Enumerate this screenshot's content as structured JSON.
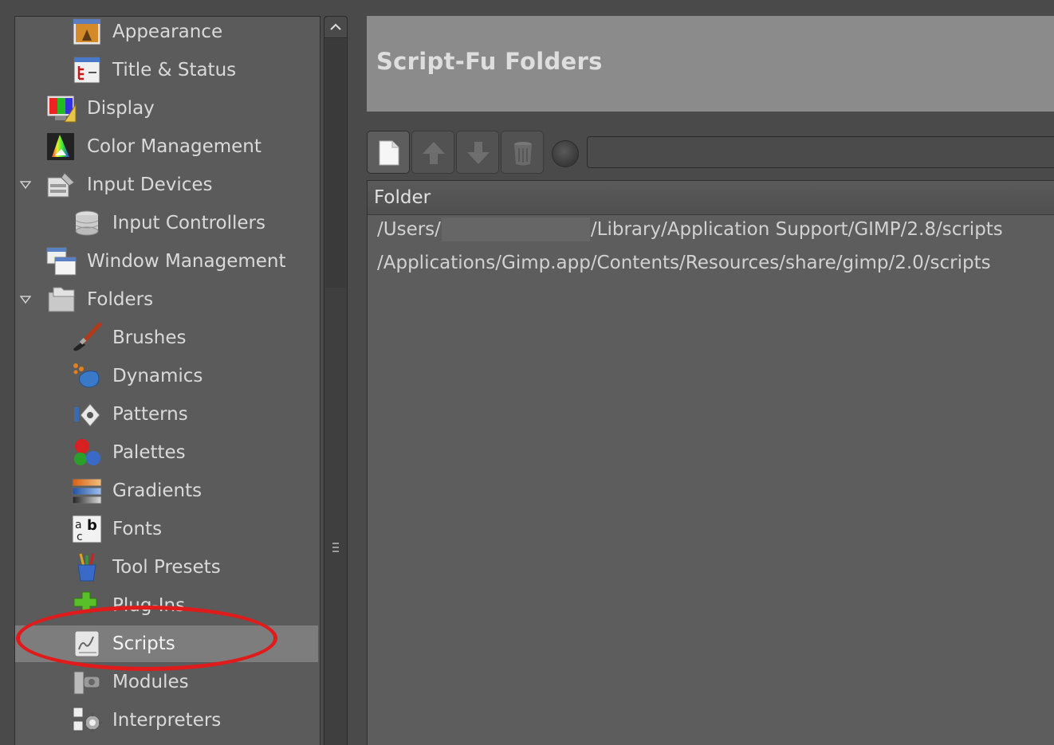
{
  "tree": {
    "items": [
      {
        "label": "Appearance",
        "icon": "appearance-icon"
      },
      {
        "label": "Title & Status",
        "icon": "title-status-icon"
      },
      {
        "label": "Display",
        "icon": "display-icon"
      },
      {
        "label": "Color Management",
        "icon": "color-management-icon"
      },
      {
        "label": "Input Devices",
        "icon": "input-devices-icon",
        "expanded": true
      },
      {
        "label": "Input Controllers",
        "icon": "input-controllers-icon"
      },
      {
        "label": "Window Management",
        "icon": "window-management-icon"
      },
      {
        "label": "Folders",
        "icon": "folders-icon",
        "expanded": true
      },
      {
        "label": "Brushes",
        "icon": "brushes-icon"
      },
      {
        "label": "Dynamics",
        "icon": "dynamics-icon"
      },
      {
        "label": "Patterns",
        "icon": "patterns-icon"
      },
      {
        "label": "Palettes",
        "icon": "palettes-icon"
      },
      {
        "label": "Gradients",
        "icon": "gradients-icon"
      },
      {
        "label": "Fonts",
        "icon": "fonts-icon"
      },
      {
        "label": "Tool Presets",
        "icon": "tool-presets-icon"
      },
      {
        "label": "Plug-Ins",
        "icon": "plug-ins-icon"
      },
      {
        "label": "Scripts",
        "icon": "scripts-icon",
        "selected": true
      },
      {
        "label": "Modules",
        "icon": "modules-icon"
      },
      {
        "label": "Interpreters",
        "icon": "interpreters-icon"
      }
    ]
  },
  "panel": {
    "title": "Script-Fu Folders",
    "toolbar": {
      "new_icon": "new-document-icon",
      "up_icon": "arrow-up-icon",
      "down_icon": "arrow-down-icon",
      "delete_icon": "trash-icon",
      "path_value": ""
    },
    "column_header": "Folder",
    "folders": [
      {
        "prefix": "/Users/",
        "suffix": "/Library/Application Support/GIMP/2.8/scripts",
        "redacted": true
      },
      {
        "prefix": "/Applications/Gimp.app/Contents/Resources/share/gimp/2.0/scripts",
        "suffix": "",
        "redacted": false
      }
    ]
  },
  "colors": {
    "highlight": "#e01b1b",
    "selected_row": "#7d7d7d",
    "header_bg": "#8b8b8b"
  }
}
